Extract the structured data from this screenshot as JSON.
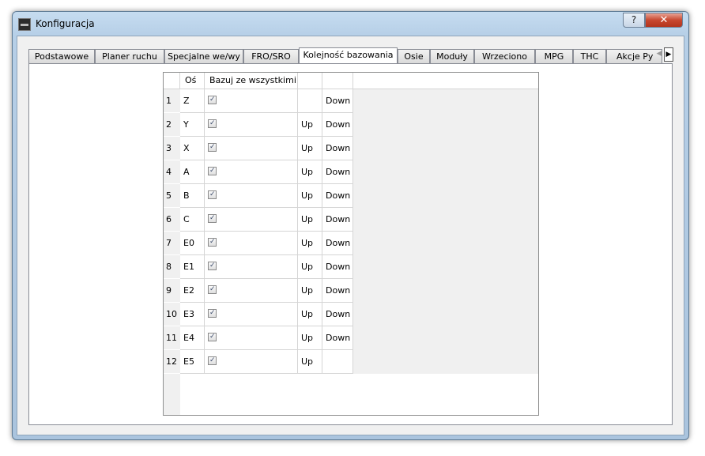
{
  "window": {
    "title": "Konfiguracja",
    "help_label": "?",
    "close_label": "✕"
  },
  "tabs": [
    {
      "label": "Podstawowe"
    },
    {
      "label": "Planer ruchu"
    },
    {
      "label": "Specjalne we/wy"
    },
    {
      "label": "FRO/SRO"
    },
    {
      "label": "Kolejność bazowania",
      "active": true
    },
    {
      "label": "Osie"
    },
    {
      "label": "Moduły"
    },
    {
      "label": "Wrzeciono"
    },
    {
      "label": "MPG"
    },
    {
      "label": "THC"
    },
    {
      "label": "Akcje Py"
    }
  ],
  "tab_scroll": {
    "left": "◀",
    "right": "▶"
  },
  "table": {
    "headers": [
      "Oś",
      "Bazuj ze wszystkimi",
      "",
      ""
    ],
    "rows": [
      {
        "num": "1",
        "axis": "Z",
        "checked": true,
        "up": "",
        "down": "Down"
      },
      {
        "num": "2",
        "axis": "Y",
        "checked": true,
        "up": "Up",
        "down": "Down"
      },
      {
        "num": "3",
        "axis": "X",
        "checked": true,
        "up": "Up",
        "down": "Down"
      },
      {
        "num": "4",
        "axis": "A",
        "checked": true,
        "up": "Up",
        "down": "Down"
      },
      {
        "num": "5",
        "axis": "B",
        "checked": true,
        "up": "Up",
        "down": "Down"
      },
      {
        "num": "6",
        "axis": "C",
        "checked": true,
        "up": "Up",
        "down": "Down"
      },
      {
        "num": "7",
        "axis": "E0",
        "checked": true,
        "up": "Up",
        "down": "Down"
      },
      {
        "num": "8",
        "axis": "E1",
        "checked": true,
        "up": "Up",
        "down": "Down"
      },
      {
        "num": "9",
        "axis": "E2",
        "checked": true,
        "up": "Up",
        "down": "Down"
      },
      {
        "num": "10",
        "axis": "E3",
        "checked": true,
        "up": "Up",
        "down": "Down"
      },
      {
        "num": "11",
        "axis": "E4",
        "checked": true,
        "up": "Up",
        "down": "Down"
      },
      {
        "num": "12",
        "axis": "E5",
        "checked": true,
        "up": "Up",
        "down": ""
      }
    ]
  }
}
